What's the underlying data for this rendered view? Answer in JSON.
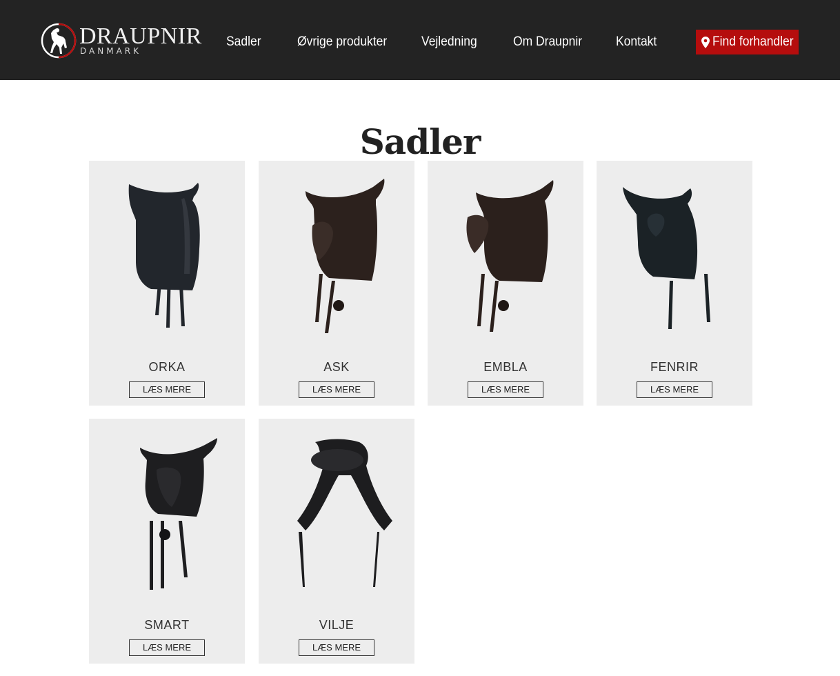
{
  "brand": {
    "title": "DRAUPNIR",
    "subtitle": "DANMARK"
  },
  "nav": [
    {
      "label": "Sadler"
    },
    {
      "label": "Øvrige produkter"
    },
    {
      "label": "Vejledning"
    },
    {
      "label": "Om Draupnir"
    },
    {
      "label": "Kontakt"
    }
  ],
  "cta": {
    "label": "Find forhandler",
    "icon": "map-pin-icon",
    "color": "#b50d0d"
  },
  "page_title": "Sadler",
  "products": [
    {
      "name": "ORKA",
      "button": "LÆS MERE",
      "color": "#22262c"
    },
    {
      "name": "ASK",
      "button": "LÆS MERE",
      "color": "#2c211d"
    },
    {
      "name": "EMBLA",
      "button": "LÆS MERE",
      "color": "#2b201c"
    },
    {
      "name": "FENRIR",
      "button": "LÆS MERE",
      "color": "#1b2226"
    },
    {
      "name": "SMART",
      "button": "LÆS MERE",
      "color": "#1e1e20"
    },
    {
      "name": "VILJE",
      "button": "LÆS MERE",
      "color": "#1d1d1f"
    }
  ],
  "colors": {
    "header_bg": "#232323",
    "card_bg": "#ededed"
  }
}
